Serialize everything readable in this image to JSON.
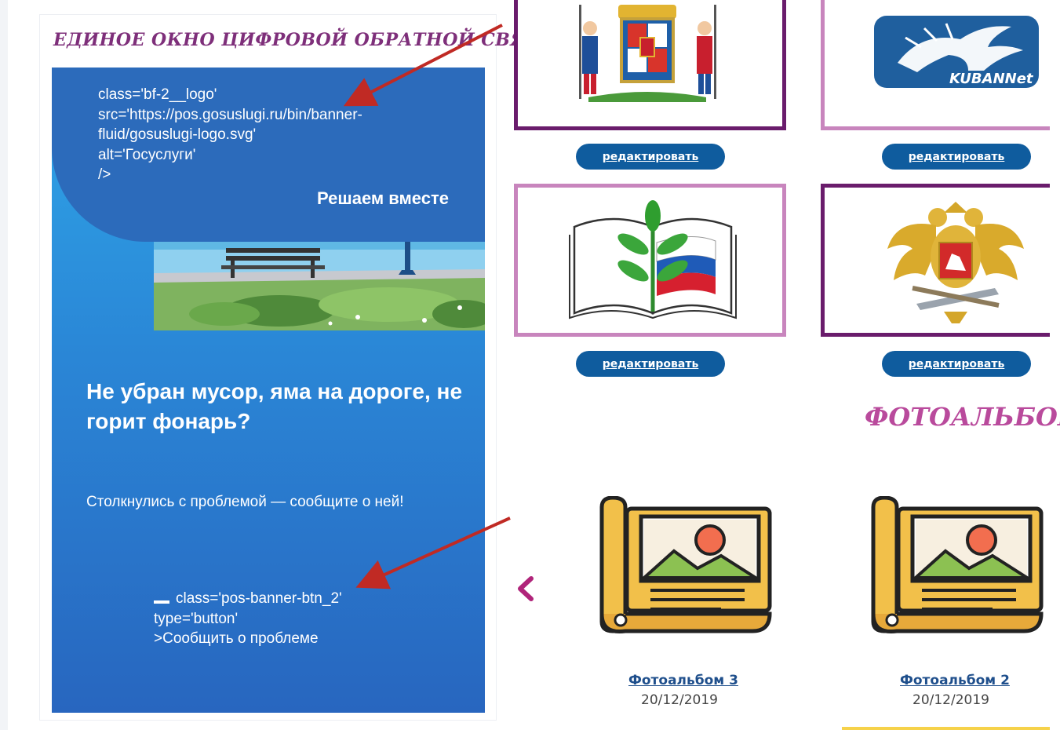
{
  "left_panel": {
    "title": "ЕДИНОЕ ОКНО ЦИФРОВОЙ ОБРАТНОЙ СВЯЗИ",
    "banner": {
      "logo_code": "class='bf-2__logo'\nsrc='https://pos.gosuslugi.ru/bin/banner-\nfluid/gosuslugi-logo.svg'\nalt='Госуслуги'\n/>",
      "slogan": "Решаем вместе",
      "headline": "Не убран мусор, яма на дороге, не горит фонарь?",
      "subtext": "Столкнулись с проблемой — сообщите о ней!",
      "button_code": "class='pos-banner-btn_2'\ntype='button'\n>Сообщить о проблеме"
    }
  },
  "cards": [
    {
      "icon": "krasnodar-coat-of-arms-icon",
      "edit_label": "редактировать"
    },
    {
      "icon": "kubannet-logo-icon",
      "logo_text": "KUBANNet",
      "edit_label": "редактировать"
    },
    {
      "icon": "education-book-icon",
      "edit_label": "редактировать"
    },
    {
      "icon": "russia-coat-of-arms-icon",
      "edit_label": "редактировать"
    }
  ],
  "photo_section": {
    "title": "ФОТОАЛЬБОМ",
    "albums": [
      {
        "title": "Фотоальбом 3",
        "date": "20/12/2019",
        "icon": "photo-scroll-icon"
      },
      {
        "title": "Фотоальбом 2",
        "date": "20/12/2019",
        "icon": "photo-scroll-icon"
      }
    ],
    "prev_icon": "chevron-left-icon"
  },
  "colors": {
    "title_purple": "#7e2f7a",
    "card_dark": "#6a1c6c",
    "card_light": "#c885bd",
    "button_blue": "#0f5c9e",
    "section_pink": "#b94a9c",
    "banner_blue": "#2a86d6",
    "arrow_red": "#c02a24"
  }
}
